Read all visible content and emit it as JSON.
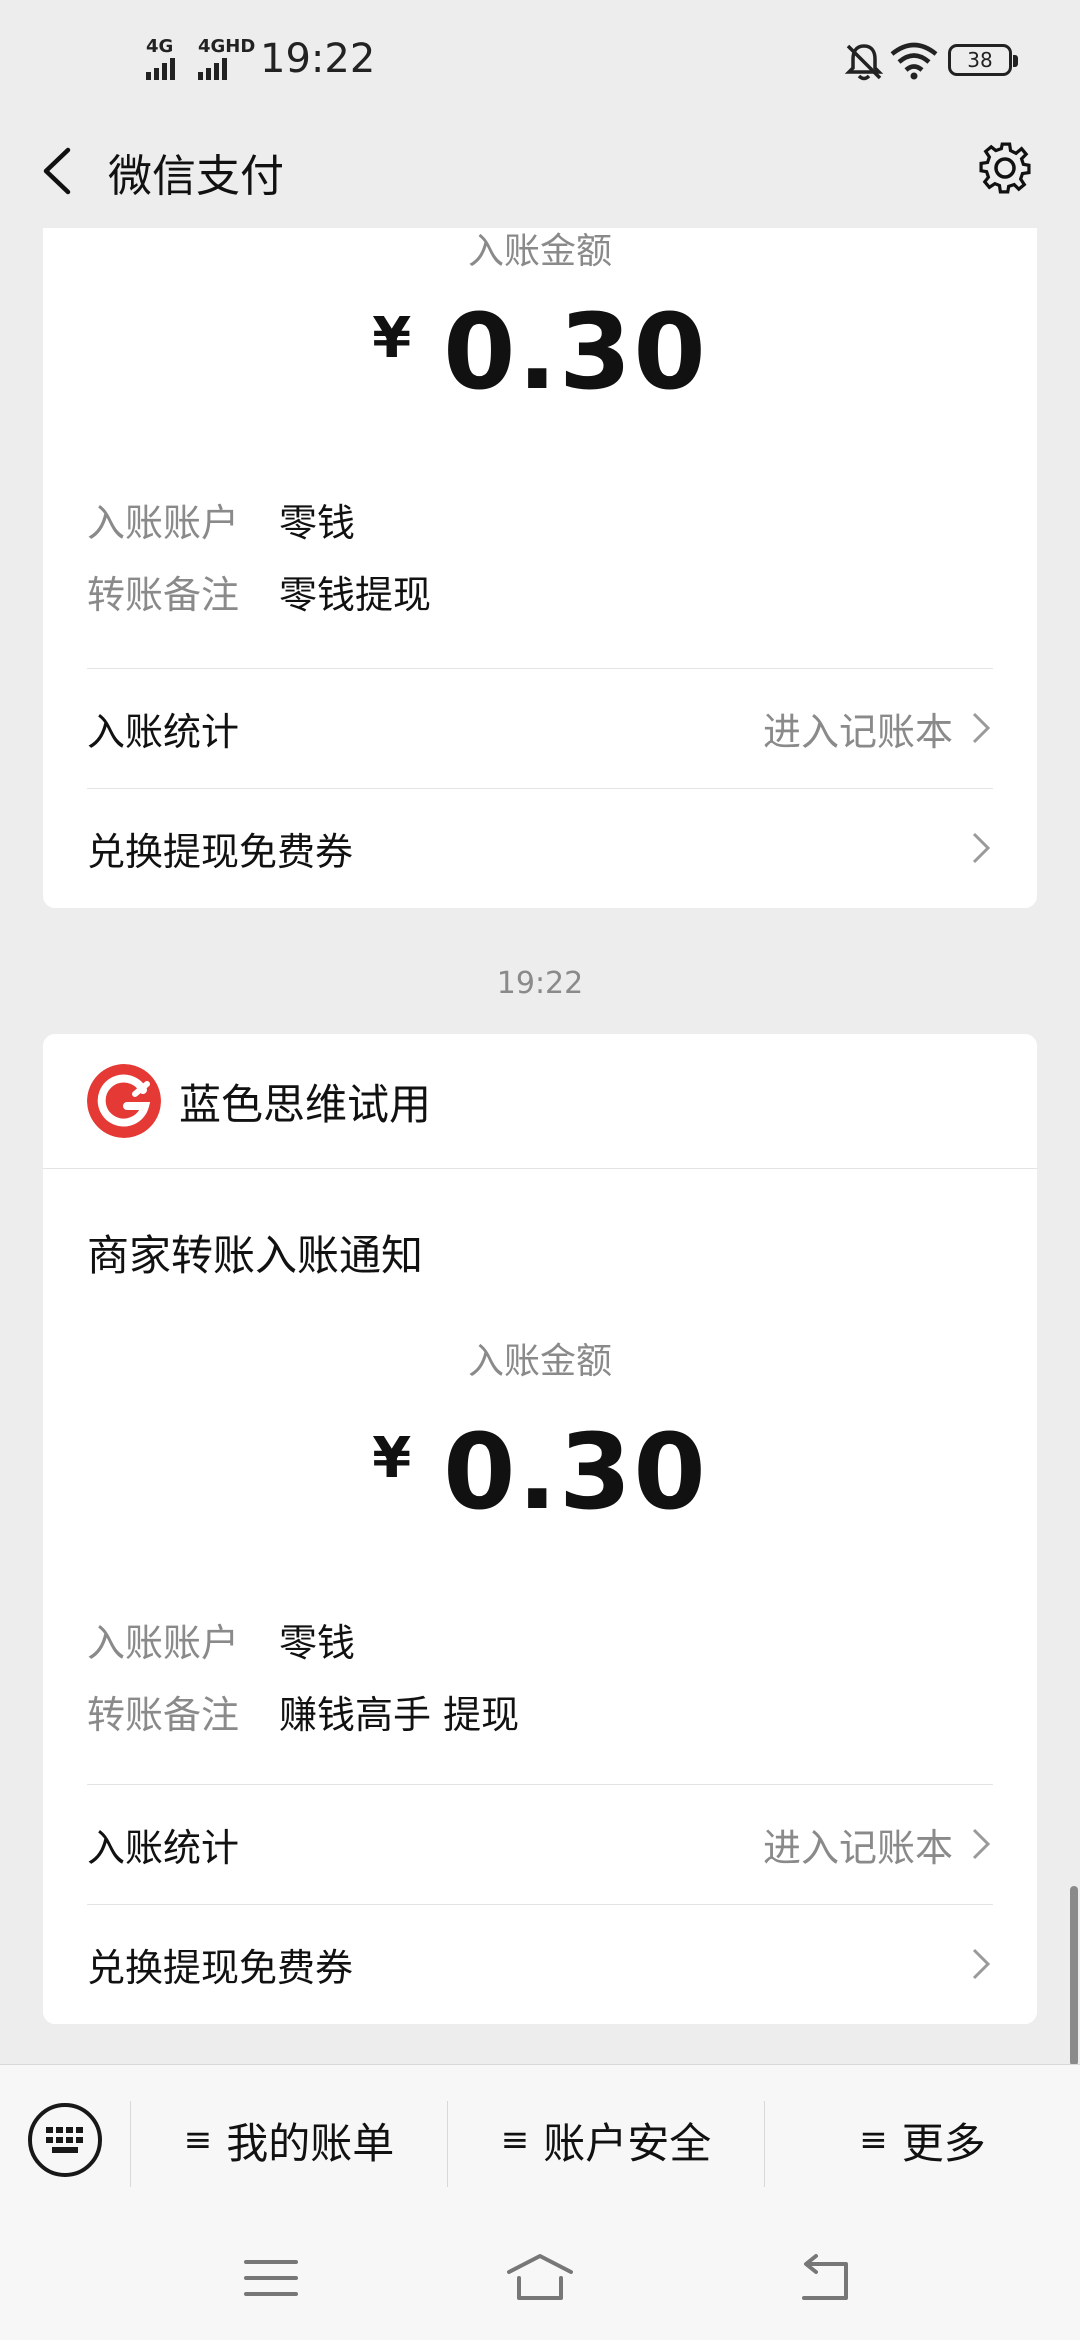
{
  "status_bar": {
    "sim1": "4G",
    "sim2": "4GHD",
    "time": "19:22",
    "battery": "38"
  },
  "nav": {
    "title": "微信支付"
  },
  "card1": {
    "amount_label": "入账金额",
    "currency": "¥",
    "amount": "0.30",
    "rows": [
      {
        "key": "入账账户",
        "value": "零钱"
      },
      {
        "key": "转账备注",
        "value": "零钱提现"
      }
    ],
    "stats_label": "入账统计",
    "stats_extra": "进入记账本",
    "coupon_label": "兑换提现免费券"
  },
  "timestamp": "19:22",
  "card2": {
    "merchant_name": "蓝色思维试用",
    "notice_title": "商家转账入账通知",
    "amount_label": "入账金额",
    "currency": "¥",
    "amount": "0.30",
    "rows": [
      {
        "key": "入账账户",
        "value": "零钱"
      },
      {
        "key": "转账备注",
        "value": "赚钱高手 提现"
      }
    ],
    "stats_label": "入账统计",
    "stats_extra": "进入记账本",
    "coupon_label": "兑换提现免费券"
  },
  "bottom_menu": {
    "items": [
      {
        "icon": "≡",
        "label": "我的账单"
      },
      {
        "icon": "≡",
        "label": "账户安全"
      },
      {
        "icon": "≡",
        "label": "更多"
      }
    ]
  },
  "colors": {
    "background": "#ededed",
    "card": "#ffffff",
    "muted_text": "#8a8a8a",
    "logo_red": "#e53935"
  }
}
